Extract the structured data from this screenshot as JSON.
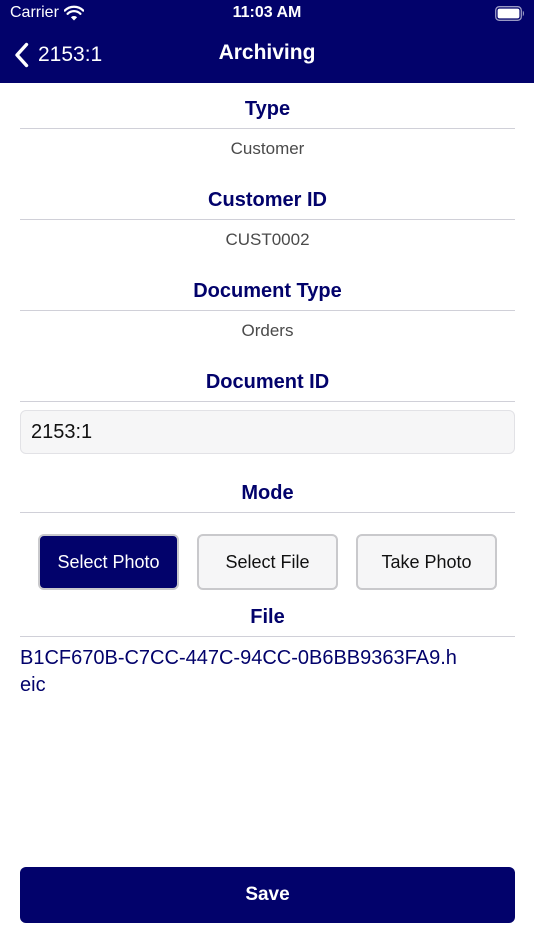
{
  "status_bar": {
    "carrier": "Carrier",
    "time": "11:03 AM",
    "icons": [
      "wifi-icon",
      "battery-icon"
    ]
  },
  "nav": {
    "back_label": "2153:1",
    "title": "Archiving",
    "back_icon": "chevron-left-icon"
  },
  "form": {
    "type": {
      "label": "Type",
      "value": "Customer"
    },
    "customer_id": {
      "label": "Customer ID",
      "value": "CUST0002"
    },
    "document_type": {
      "label": "Document Type",
      "value": "Orders"
    },
    "document_id": {
      "label": "Document ID",
      "value": "2153:1"
    },
    "mode": {
      "label": "Mode",
      "options": [
        "Select Photo",
        "Select File",
        "Take Photo"
      ],
      "selected": "Select Photo"
    },
    "file": {
      "label": "File",
      "value": "B1CF670B-C7CC-447C-94CC-0B6BB9363FA9.heic"
    }
  },
  "actions": {
    "save_label": "Save"
  },
  "colors": {
    "primary": "#02026b",
    "divider": "#d0d0d8",
    "value_text": "#4a4a4a",
    "input_background": "#f6f6f7"
  }
}
